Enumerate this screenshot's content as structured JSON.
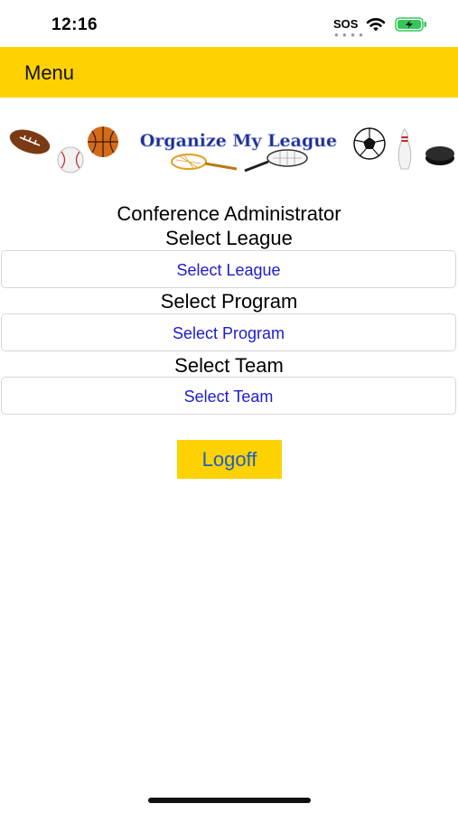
{
  "status": {
    "time": "12:16",
    "sos": "SOS"
  },
  "menu": {
    "label": "Menu"
  },
  "banner": {
    "title": "Organize My League"
  },
  "form": {
    "role": "Conference Administrator",
    "league_label": "Select League",
    "league_button": "Select League",
    "program_label": "Select Program",
    "program_button": "Select Program",
    "team_label": "Select Team",
    "team_button": "Select Team"
  },
  "actions": {
    "logoff": "Logoff"
  },
  "colors": {
    "accent": "#fed200",
    "link": "#1c1ccf",
    "logoff_text": "#1f5fc1"
  }
}
